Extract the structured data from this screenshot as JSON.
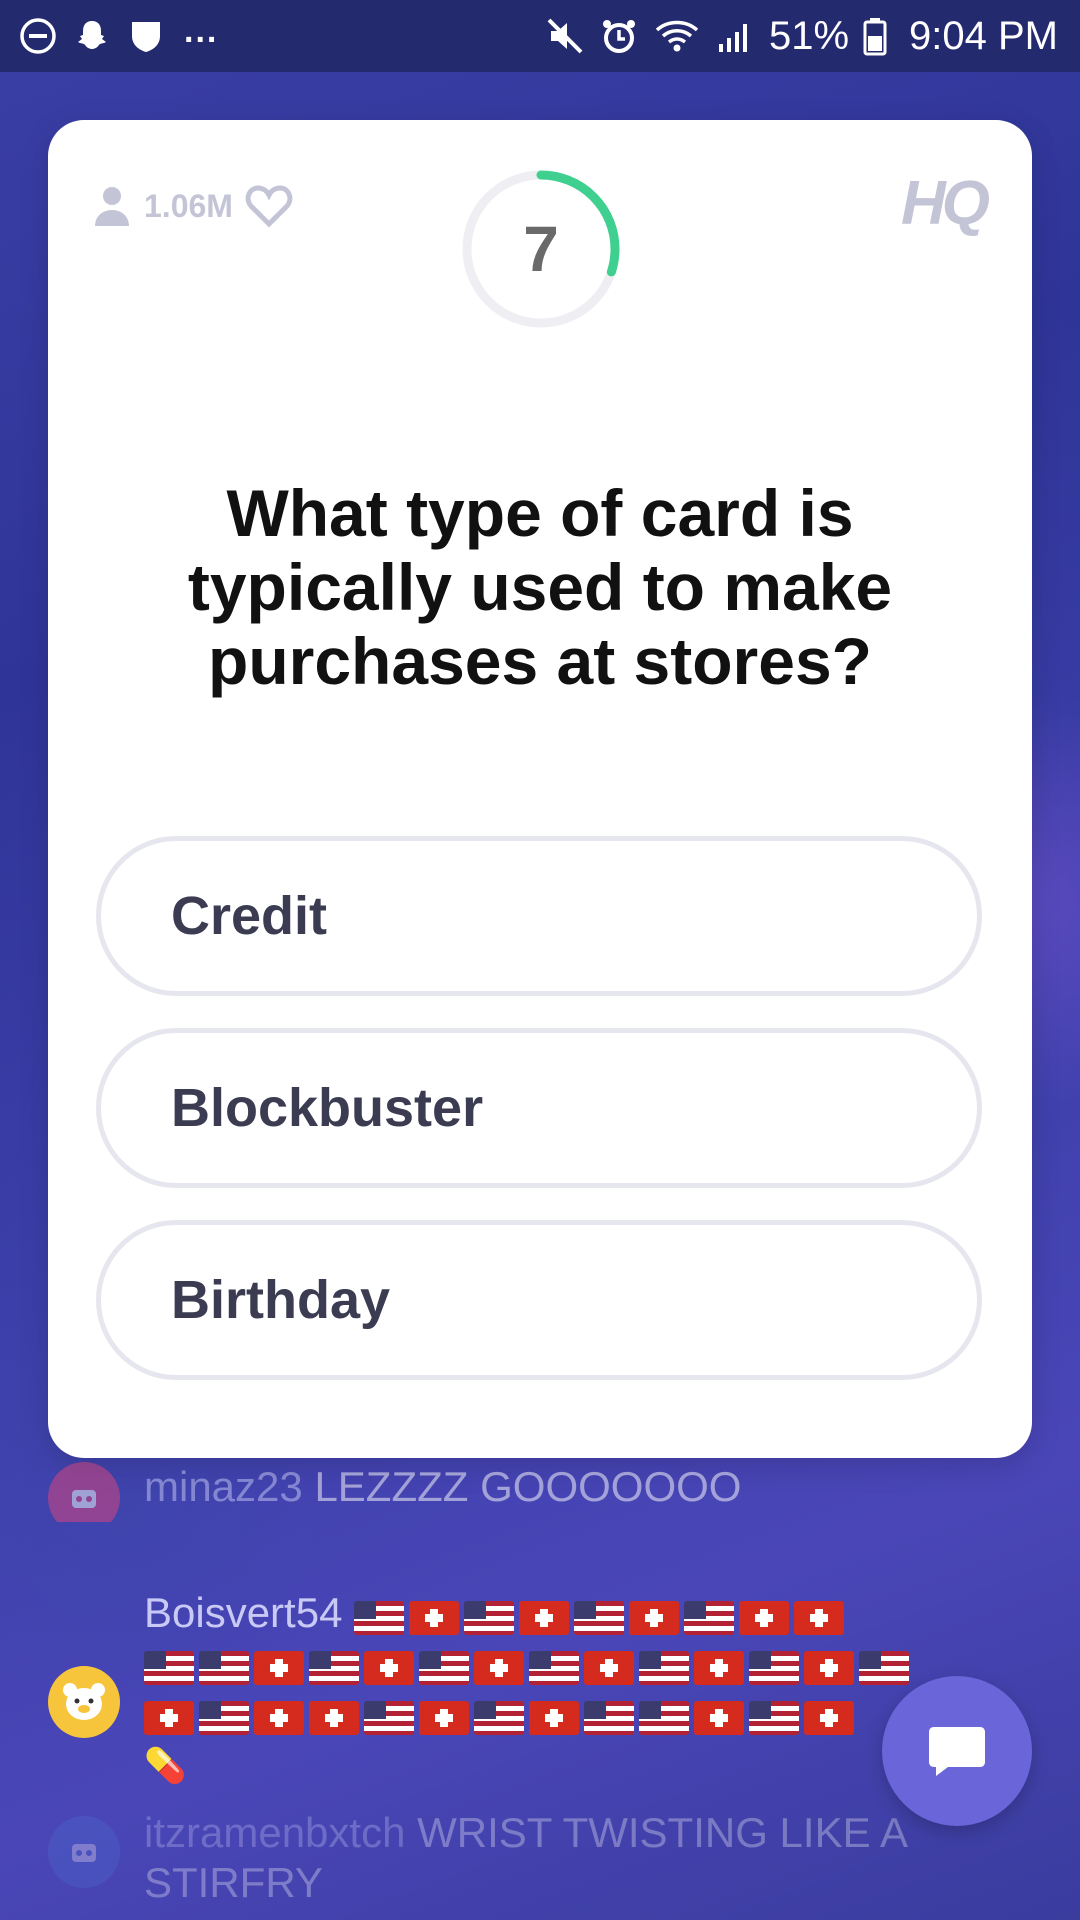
{
  "status_bar": {
    "battery_percent": "51%",
    "time": "9:04 PM",
    "more_indicator": "...",
    "icons": [
      "do-not-disturb-icon",
      "snapchat-icon",
      "shield-icon",
      "mute-icon",
      "alarm-icon",
      "wifi-icon",
      "signal-icon",
      "battery-icon"
    ]
  },
  "card": {
    "viewer_count": "1.06M",
    "timer": {
      "value": "7",
      "remaining_fraction": 0.3
    },
    "logo": "HQ",
    "question": "What type of card is typically used to make purchases at stores?",
    "answers": [
      "Credit",
      "Blockbuster",
      "Birthday"
    ]
  },
  "chat": {
    "messages": [
      {
        "user": "minaz23",
        "text": "LEZZZZ GOOOOOOO",
        "avatar": "robot-avatar-icon"
      },
      {
        "user": "Boisvert54",
        "text": "",
        "avatar": "bear-avatar-icon",
        "flags_line1": [
          "us",
          "ch",
          "us",
          "ch",
          "us",
          "ch",
          "us",
          "ch",
          "ch"
        ],
        "flags_line2": [
          "us",
          "us",
          "ch",
          "us",
          "ch",
          "us",
          "ch",
          "us",
          "ch",
          "us",
          "ch",
          "us",
          "ch",
          "us"
        ],
        "flags_line3": [
          "ch",
          "us",
          "ch",
          "ch",
          "us",
          "ch",
          "us",
          "ch",
          "us",
          "us",
          "ch",
          "us",
          "ch"
        ],
        "extra": "💊"
      },
      {
        "user": "itzramenbxtch",
        "text": "WRIST TWISTING LIKE A STIRFRY",
        "avatar": "robot-avatar-icon"
      }
    ]
  },
  "colors": {
    "background": "#3a3fa6",
    "timer_green": "#3fcf8e",
    "chat_button": "#6a66d9"
  }
}
